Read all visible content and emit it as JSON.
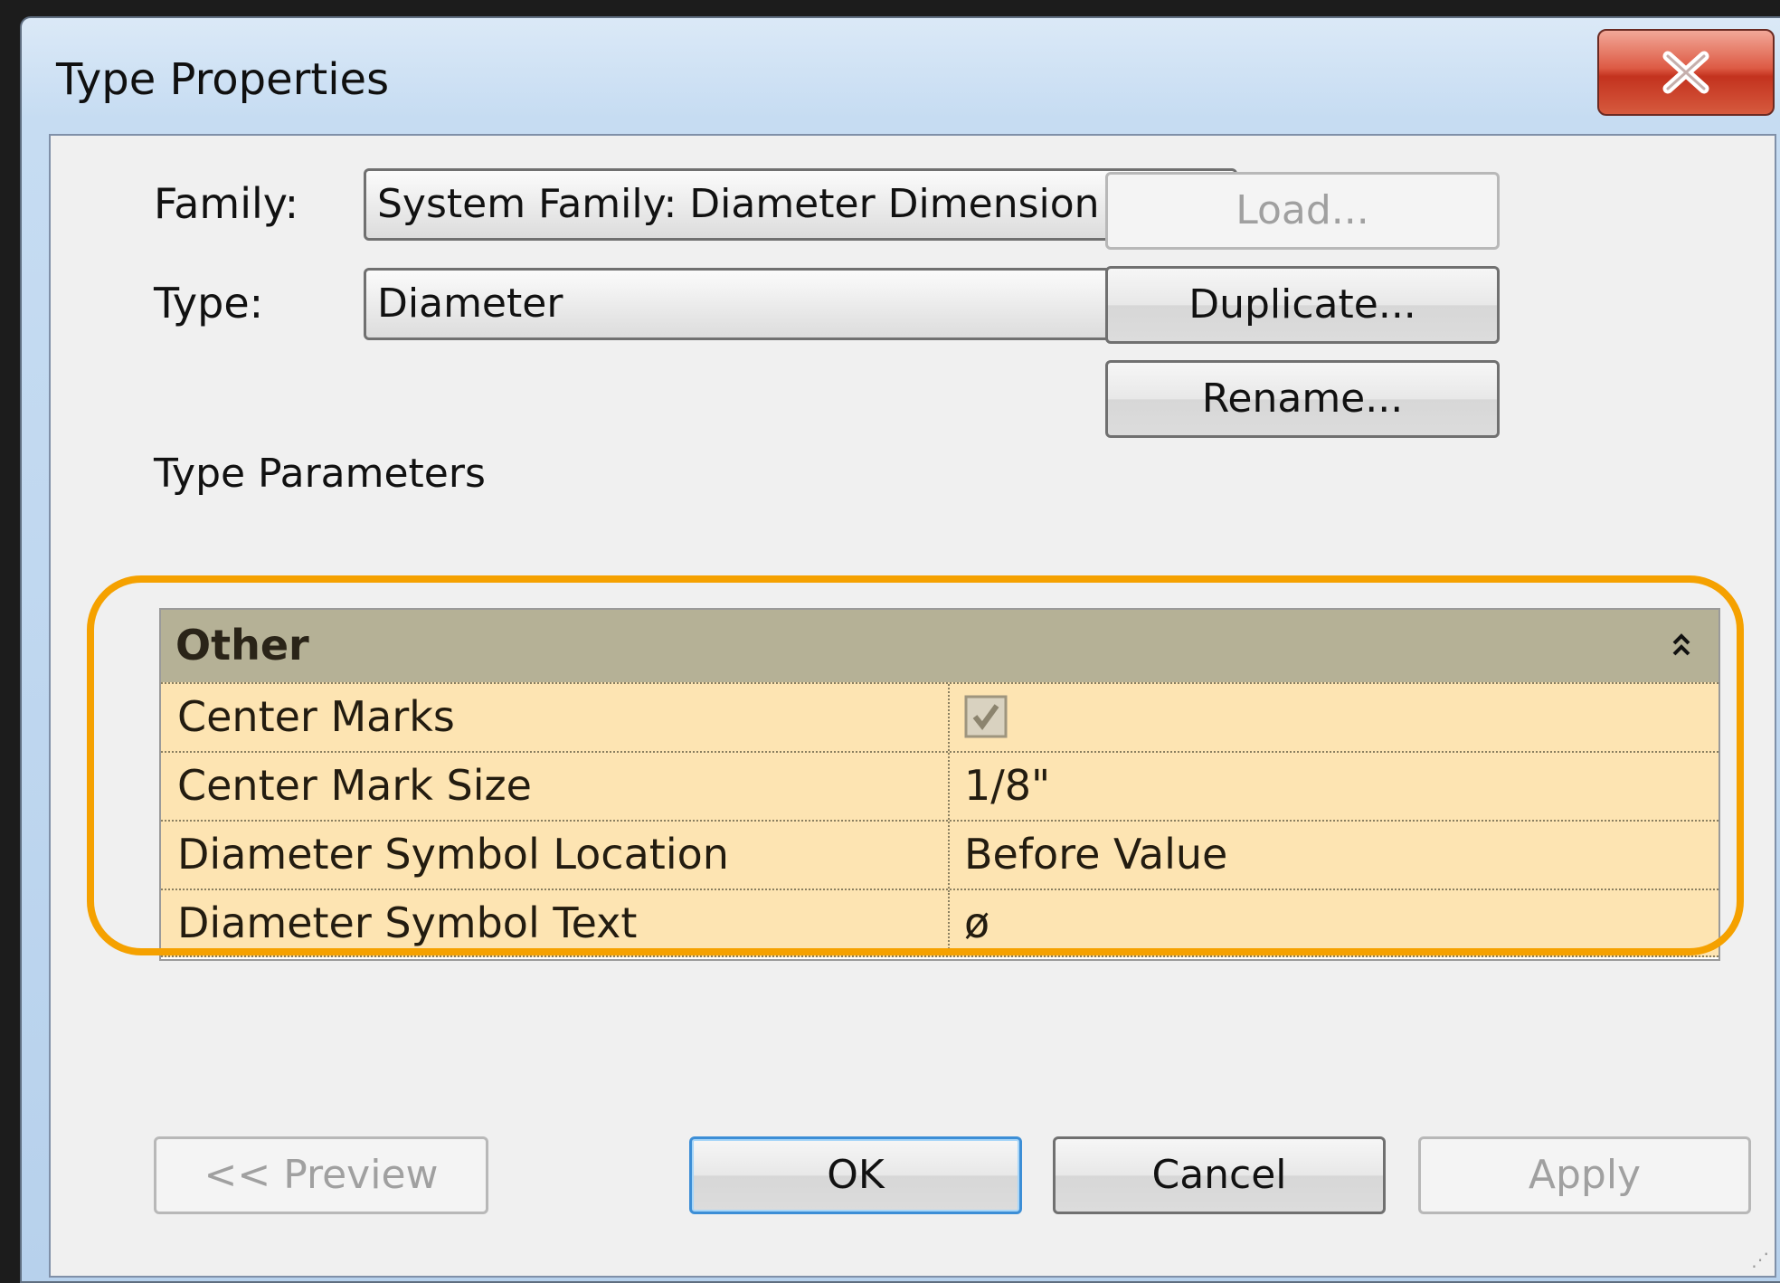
{
  "window": {
    "title": "Type Properties"
  },
  "family": {
    "label": "Family:",
    "value": "System Family: Diameter Dimension Style"
  },
  "type": {
    "label": "Type:",
    "value": "Diameter"
  },
  "buttons": {
    "load": "Load...",
    "duplicate": "Duplicate...",
    "rename": "Rename...",
    "preview": "<< Preview",
    "ok": "OK",
    "cancel": "Cancel",
    "apply": "Apply"
  },
  "parameters": {
    "section_label": "Type Parameters",
    "group": "Other",
    "rows": [
      {
        "name": "Center Marks",
        "value": "",
        "checked": true
      },
      {
        "name": "Center Mark Size",
        "value": "1/8\""
      },
      {
        "name": "Diameter Symbol Location",
        "value": "Before Value"
      },
      {
        "name": "Diameter Symbol Text",
        "value": "ø"
      }
    ]
  },
  "colors": {
    "highlight": "#f5a100",
    "group_header": "#b5b196",
    "row_background": "#fde4b2",
    "title_bar": "#c6dcf2",
    "close_button": "#c3321e"
  },
  "icons": [
    "close-icon",
    "dropdown-arrow-icon",
    "collapse-icon",
    "checkbox-icon",
    "resize-grip-icon"
  ]
}
